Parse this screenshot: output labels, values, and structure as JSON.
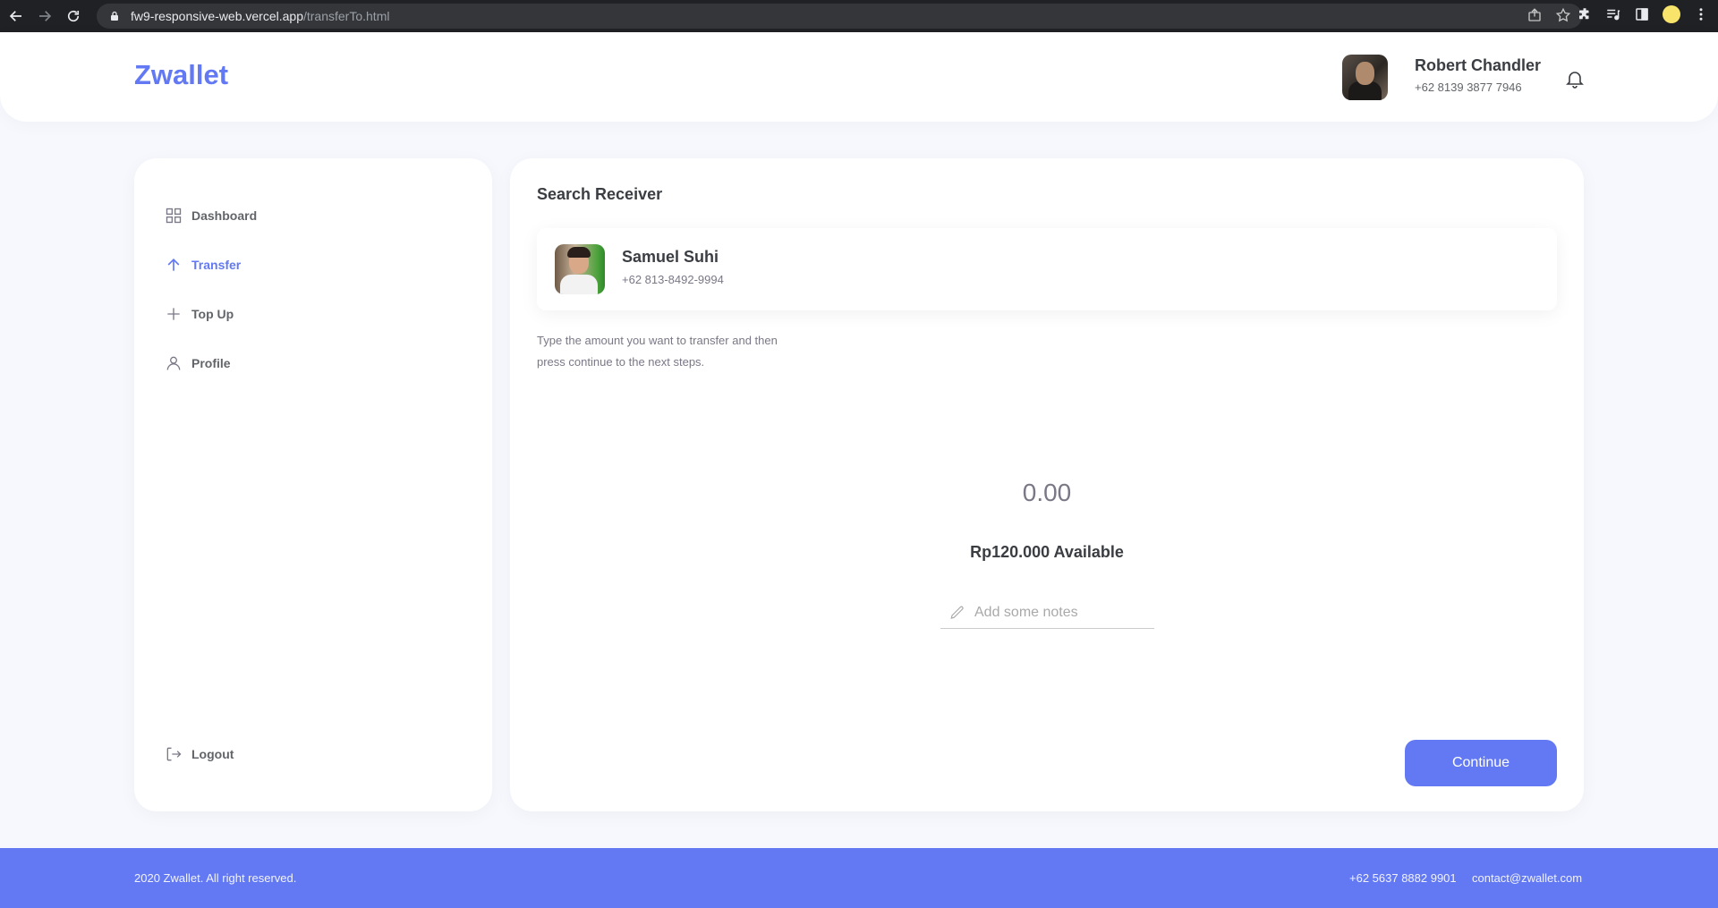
{
  "browser": {
    "url_host": "fw9-responsive-web.vercel.app",
    "url_path": "/transferTo.html"
  },
  "header": {
    "logo": "Zwallet",
    "user": {
      "name": "Robert Chandler",
      "phone": "+62 8139 3877 7946"
    }
  },
  "sidebar": {
    "items": [
      {
        "label": "Dashboard",
        "icon": "grid-icon",
        "active": false
      },
      {
        "label": "Transfer",
        "icon": "arrow-up-icon",
        "active": true
      },
      {
        "label": "Top Up",
        "icon": "plus-icon",
        "active": false
      },
      {
        "label": "Profile",
        "icon": "user-icon",
        "active": false
      }
    ],
    "logout_label": "Logout"
  },
  "main": {
    "title": "Search Receiver",
    "receiver": {
      "name": "Samuel Suhi",
      "phone": "+62 813-8492-9994"
    },
    "instructions": "Type the amount you want to transfer and then press continue to the next steps.",
    "amount": "0.00",
    "available": "Rp120.000 Available",
    "notes_placeholder": "Add some notes",
    "continue_label": "Continue"
  },
  "footer": {
    "copyright": "2020 Zwallet. All right reserved.",
    "phone": "+62 5637 8882 9901",
    "email": "contact@zwallet.com"
  },
  "colors": {
    "primary": "#6379f4",
    "background": "#f6f8fd",
    "text": "#3a3d42"
  }
}
